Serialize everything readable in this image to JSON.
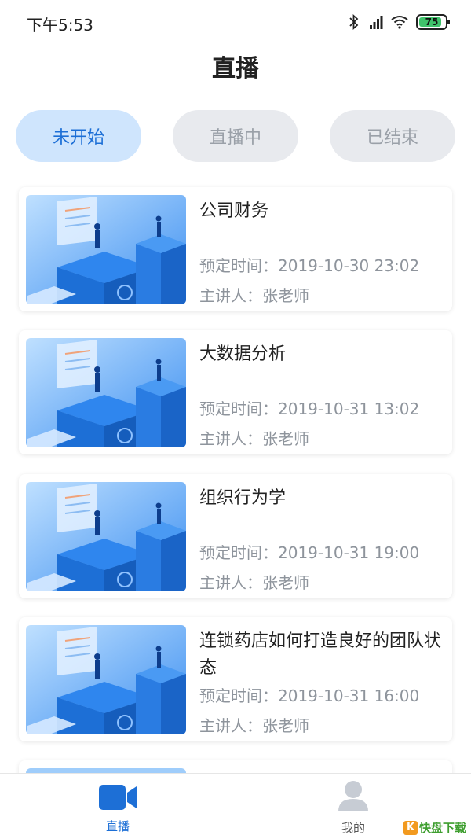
{
  "status_bar": {
    "time": "下午5:53",
    "battery_level": "75",
    "icons": [
      "bluetooth-icon",
      "signal-icon",
      "wifi-icon",
      "battery-icon"
    ]
  },
  "header": {
    "title": "直播"
  },
  "tabs": [
    {
      "label": "未开始",
      "active": true
    },
    {
      "label": "直播中",
      "active": false
    },
    {
      "label": "已结束",
      "active": false
    }
  ],
  "items": [
    {
      "title": "公司财务",
      "time": "预定时间：2019-10-30 23:02",
      "host": "主讲人：张老师"
    },
    {
      "title": "大数据分析",
      "time": "预定时间：2019-10-31 13:02",
      "host": "主讲人：张老师"
    },
    {
      "title": "组织行为学",
      "time": "预定时间：2019-10-31 19:00",
      "host": "主讲人：张老师"
    },
    {
      "title": "连锁药店如何打造良好的团队状态",
      "time": "预定时间：2019-10-31 16:00",
      "host": "主讲人：张老师"
    }
  ],
  "bottom_nav": [
    {
      "label": "直播",
      "icon": "video-camera-icon",
      "active": true
    },
    {
      "label": "我的",
      "icon": "user-icon",
      "active": false
    }
  ],
  "watermark": {
    "badge": "K",
    "text": "快盘下载"
  },
  "colors": {
    "accent": "#1d6fd6",
    "tab_active_bg": "#cfe5fd",
    "tab_inactive_bg": "#e8eaee",
    "battery": "#3fc36b"
  }
}
